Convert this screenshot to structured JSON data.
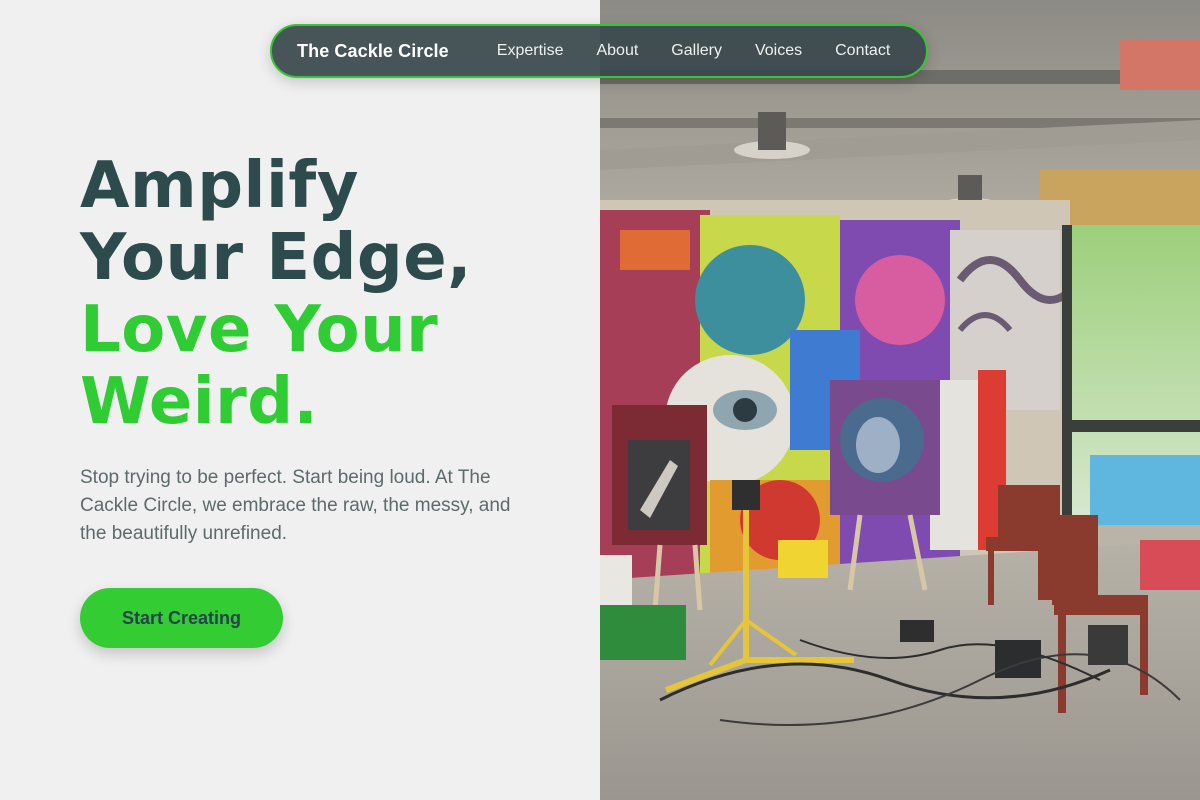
{
  "nav": {
    "brand": "The Cackle Circle",
    "links": [
      {
        "label": "Expertise"
      },
      {
        "label": "About"
      },
      {
        "label": "Gallery"
      },
      {
        "label": "Voices"
      },
      {
        "label": "Contact"
      }
    ]
  },
  "hero": {
    "title_lines_dark": [
      "Amplify",
      "Your Edge,"
    ],
    "title_lines_green": [
      "Love Your",
      "Weird."
    ],
    "description": "Stop trying to be perfect. Start being loud. At The Cackle Circle, we embrace the raw, the messy, and the beautifully unrefined.",
    "cta_label": "Start Creating"
  },
  "colors": {
    "accent_green": "#33cc33",
    "heading_dark": "#2d4a4c",
    "nav_background": "#3a484c"
  }
}
